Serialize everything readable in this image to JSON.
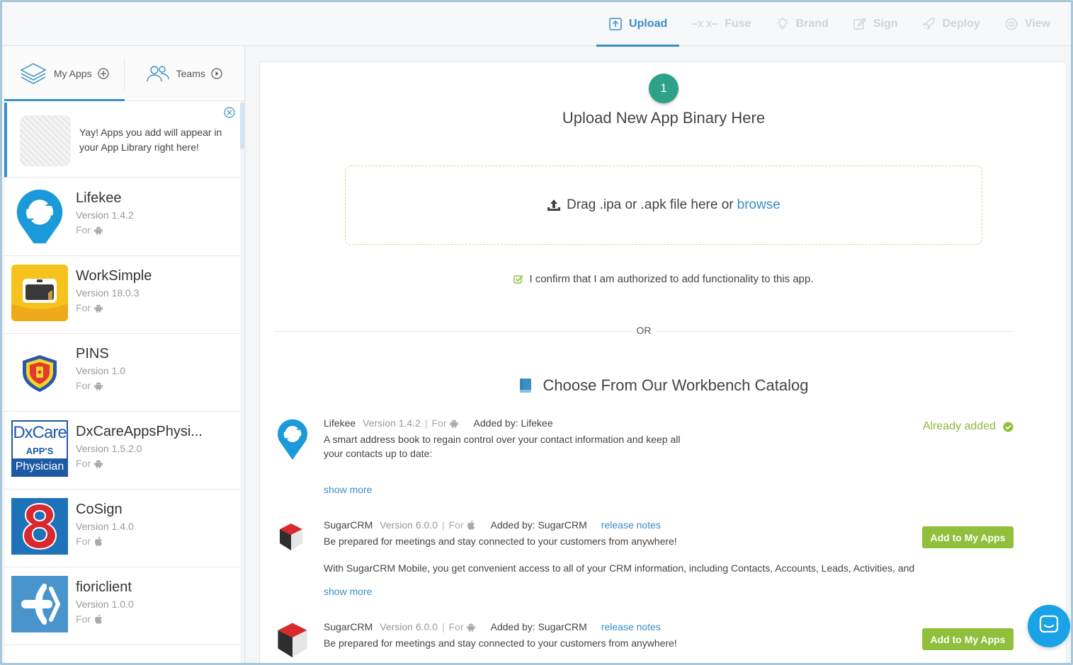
{
  "nav": {
    "steps": [
      {
        "label": "Upload",
        "icon": "upload-icon",
        "active": true
      },
      {
        "label": "Fuse",
        "icon": "fuse-icon"
      },
      {
        "label": "Brand",
        "icon": "lightbulb-icon"
      },
      {
        "label": "Sign",
        "icon": "edit-icon"
      },
      {
        "label": "Deploy",
        "icon": "rocket-icon"
      },
      {
        "label": "View",
        "icon": "eye-icon"
      }
    ]
  },
  "sidebar": {
    "tabs": {
      "my_apps": "My Apps",
      "teams": "Teams"
    },
    "banner_text": "Yay! Apps you add will appear in your App Library right here!",
    "apps": [
      {
        "name": "Lifekee",
        "version": "Version 1.4.2",
        "for_label": "For",
        "platform": "android"
      },
      {
        "name": "WorkSimple",
        "version": "Version 18.0.3",
        "for_label": "For",
        "platform": "android"
      },
      {
        "name": "PINS",
        "version": "Version 1.0",
        "for_label": "For",
        "platform": "android"
      },
      {
        "name": "DxCareAppsPhysi...",
        "version": "Version 1.5.2.0",
        "for_label": "For",
        "platform": "android"
      },
      {
        "name": "CoSign",
        "version": "Version 1.4.0",
        "for_label": "For",
        "platform": "apple"
      },
      {
        "name": "fioriclient",
        "version": "Version 1.0.0",
        "for_label": "For",
        "platform": "apple"
      }
    ],
    "dxcare_logo": {
      "line1": "DxCare",
      "line2": "APP'S",
      "line3": "Physician"
    }
  },
  "main": {
    "step_number": "1",
    "upload_title": "Upload New App Binary Here",
    "drop_text": "Drag .ipa or .apk file here or",
    "browse_label": "browse",
    "confirm_text": "I confirm that I am authorized to add functionality to this app.",
    "or_label": "OR",
    "catalog_title": "Choose From Our Workbench Catalog",
    "catalog": [
      {
        "name": "Lifekee",
        "version": "Version 1.4.2",
        "for_label": "For",
        "platform": "android",
        "added_by": "Added by: Lifekee",
        "description": "A smart address book to regain control over your contact information and keep all your contacts up to date:",
        "show_more": "show more",
        "status": "Already added"
      },
      {
        "name": "SugarCRM",
        "version": "Version 6.0.0",
        "for_label": "For",
        "platform": "apple",
        "added_by": "Added by: SugarCRM",
        "release_notes": "release notes",
        "description": "Be prepared for meetings and stay connected to your customers from anywhere!",
        "extra": "With SugarCRM Mobile, you get convenient access to all of your CRM information, including Contacts, Accounts, Leads, Activities, and",
        "show_more": "show more",
        "button": "Add to My Apps"
      },
      {
        "name": "SugarCRM",
        "version": "Version 6.0.0",
        "for_label": "For",
        "platform": "android",
        "added_by": "Added by: SugarCRM",
        "release_notes": "release notes",
        "description": "Be prepared for meetings and stay connected to your customers from anywhere!",
        "button": "Add to My Apps"
      }
    ]
  },
  "colors": {
    "accent": "#3a8fc3",
    "green_button": "#8fbf3b",
    "step_badge": "#2ea18a",
    "chat": "#1aa2e6"
  }
}
